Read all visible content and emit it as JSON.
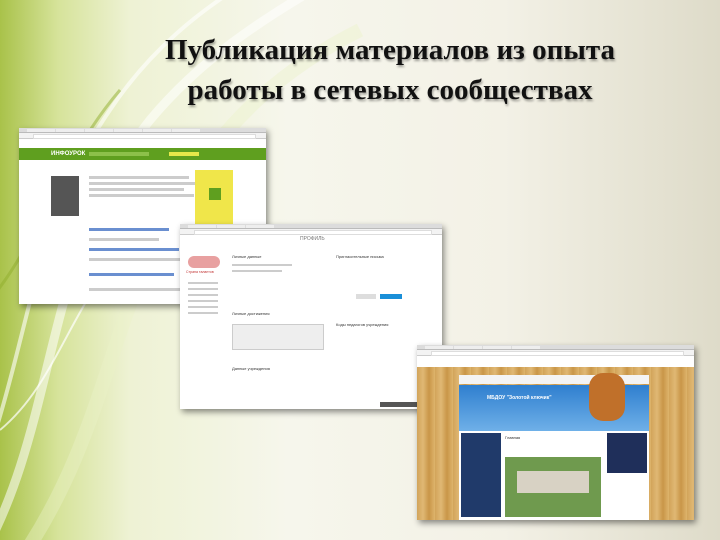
{
  "slide": {
    "title_line1": "Публикация материалов из опыта",
    "title_line2": "работы в сетевых сообществах"
  },
  "screenshots": {
    "first": {
      "site_logo": "ИНФОУРОК"
    },
    "second": {
      "site_name": "Страна талантов",
      "heading": "ПРОФИЛЬ",
      "section_personal": "Личные данные",
      "section_achievements": "Личные достижения",
      "section_institution": "Данные учреждения",
      "section_invites": "Пригласительные письма",
      "section_code": "Коды педагогов учреждения"
    },
    "third": {
      "site_name": "МБДОУ \"Золотой ключик\"",
      "page_heading": "Главная"
    }
  },
  "colors": {
    "title": "#111111",
    "background_accent": "#a9c24a",
    "site1_green": "#5f9f1f",
    "site3_sky": "#2f7fcf"
  }
}
